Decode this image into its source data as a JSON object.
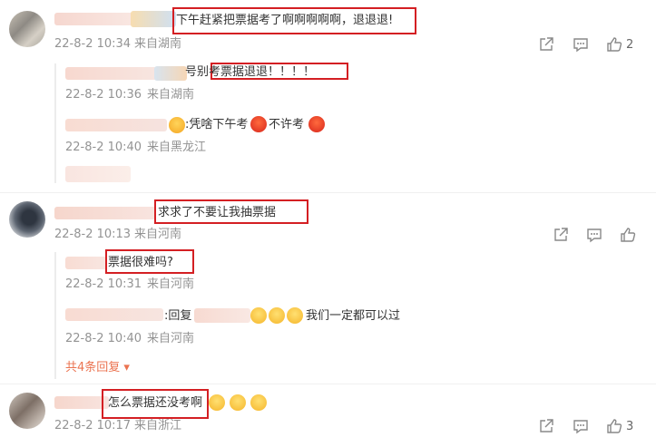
{
  "comments": [
    {
      "text": "下午赶紧把票据考了啊啊啊啊啊，退退退!",
      "time": "22-8-2 10:34",
      "source": "来自湖南",
      "likes": "2",
      "replies": [
        {
          "text": "号别考票据退退！！！！",
          "time": "22-8-2 10:36",
          "source": "来自湖南"
        },
        {
          "text": ":凭啥下午考",
          "text2": "不许考",
          "time": "22-8-2 10:40",
          "source": "来自黑龙江"
        }
      ]
    },
    {
      "text": "求求了不要让我抽票据",
      "time": "22-8-2 10:13",
      "source": "来自河南",
      "replies": [
        {
          "text": "票据很难吗?",
          "time": "22-8-2 10:31",
          "source": "来自河南"
        },
        {
          "text": ":回复",
          "text2": "我们一定都可以过",
          "time": "22-8-2 10:40",
          "source": "来自河南"
        }
      ],
      "more_replies": "共4条回复"
    },
    {
      "text": "怎么票据还没考啊",
      "time": "22-8-2 10:17",
      "source": "来自浙江",
      "likes": "3"
    }
  ],
  "icons": {
    "share": "share-icon",
    "comment": "comment-icon",
    "like": "thumbs-up-icon",
    "angry_emoji": "angry-face-icon",
    "crying_emoji": "crying-face-icon",
    "surprised_emoji": "surprised-face-icon"
  },
  "colors": {
    "highlight_box": "#d41f23",
    "meta_text": "#939393",
    "more_link": "#eb7350"
  }
}
